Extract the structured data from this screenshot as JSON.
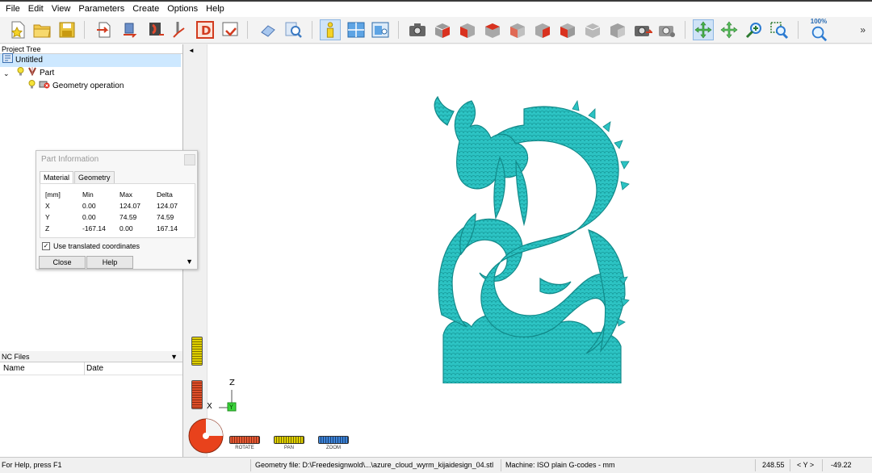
{
  "menu": [
    "File",
    "Edit",
    "View",
    "Parameters",
    "Create",
    "Options",
    "Help"
  ],
  "toolbar": {
    "zoom_label": "100%",
    "more": "»"
  },
  "project_tree": {
    "title": "Project Tree",
    "root": "Untitled",
    "part": "Part",
    "operation": "Geometry operation"
  },
  "nc_files": {
    "title": "NC Files",
    "dropdown": "▼",
    "col_name": "Name",
    "col_date": "Date"
  },
  "part_info": {
    "title": "Part Information",
    "tabs": [
      "Material",
      "Geometry"
    ],
    "headers": [
      "[mm]",
      "Min",
      "Max",
      "Delta"
    ],
    "rows": [
      [
        "X",
        "0.00",
        "124.07",
        "124.07"
      ],
      [
        "Y",
        "0.00",
        "74.59",
        "74.59"
      ],
      [
        "Z",
        "-167.14",
        "0.00",
        "167.14"
      ]
    ],
    "checkbox_label": "Use translated coordinates",
    "checkbox_checked": true,
    "close": "Close",
    "help": "Help"
  },
  "viewport": {
    "collapse_arrow": "◄",
    "axis_z": "Z",
    "axis_x": "X",
    "axis_y": "Y",
    "model_color": "#2cc3c3",
    "modes": [
      "ROTATE",
      "PAN",
      "ZOOM"
    ]
  },
  "status": {
    "help": "For Help, press F1",
    "geometry_file": "Geometry file: D:\\Freedesignwold\\...\\azure_cloud_wyrm_kijaidesign_04.stl",
    "machine": "Machine: ISO plain G-codes - mm",
    "coord1": "248.55",
    "axis": "< Y >",
    "coord2": "-49.22"
  }
}
